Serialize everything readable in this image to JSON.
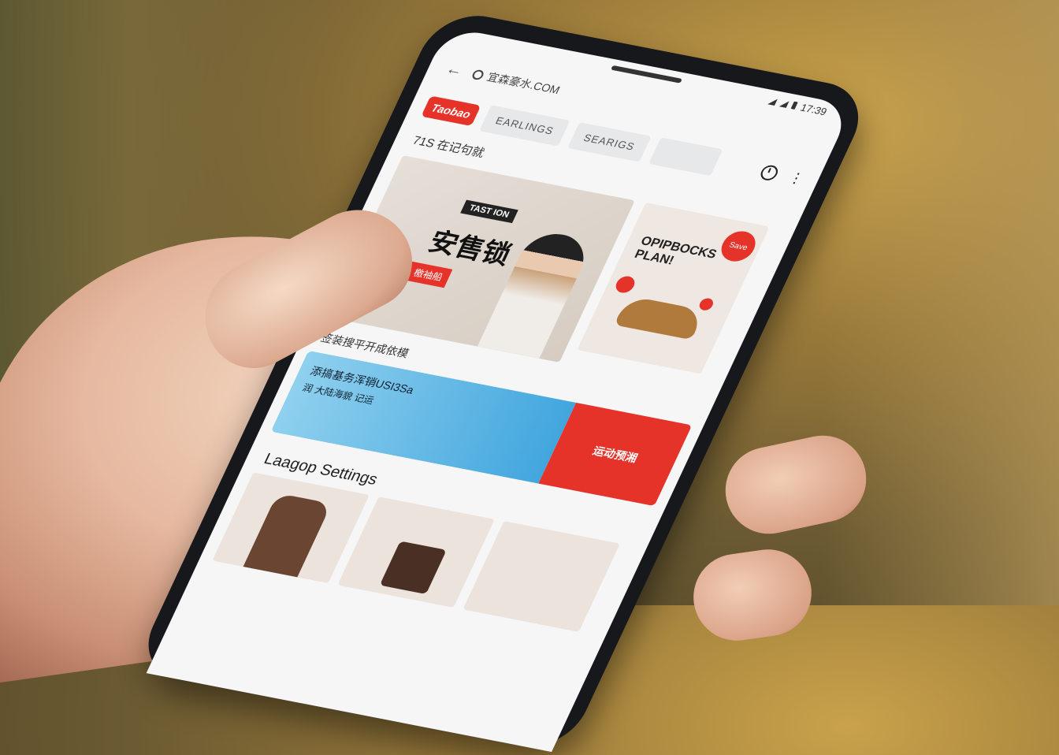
{
  "status_bar": {
    "left_text": "",
    "time": "17:39"
  },
  "address_bar": {
    "url": "宜森豪水.COM"
  },
  "toolbar": {
    "logo": "Taobao",
    "tab1": "EARLINGS",
    "tab2": "SEARIGS"
  },
  "heading": "71S 在记句就",
  "main_card": {
    "tag": "TAST ION",
    "title": "安售锁",
    "red_label": "檄袖船"
  },
  "side_card": {
    "badge": "Save",
    "title": "OPIPBOCKS PLAN!"
  },
  "subline": "签装搜平开成依模",
  "banner": {
    "line1": "添搞基务浑销USI3Sa",
    "line2": "润 大陆海貌 记运",
    "right_text": "运动预湘"
  },
  "section_title": "Laagop Settings",
  "colors": {
    "accent_red": "#e6332a",
    "banner_blue": "#42a6de"
  }
}
